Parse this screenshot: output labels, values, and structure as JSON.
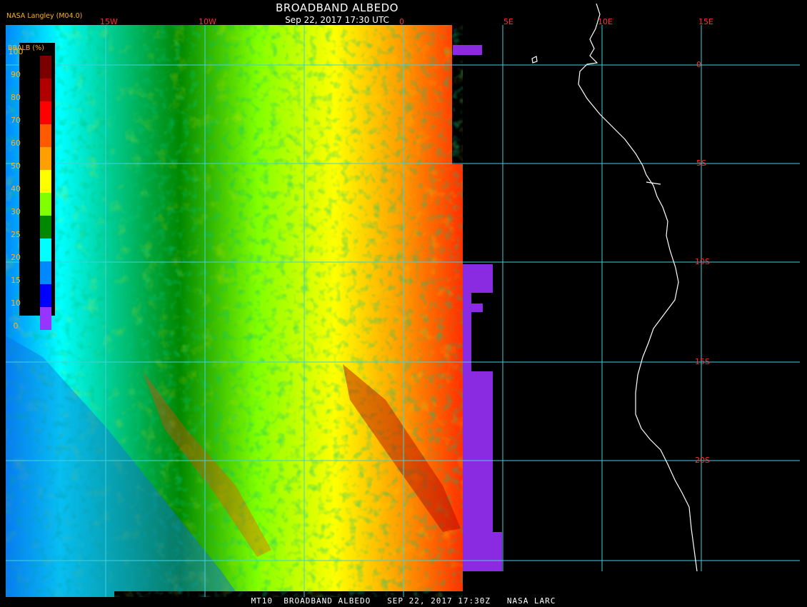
{
  "header": {
    "producer": "NASA Langley (M04.0)",
    "title": "BROADBAND ALBEDO",
    "subtitle": "Sep 22, 2017 17:30 UTC"
  },
  "footer": "MT10  BROADBAND ALBEDO   SEP 22, 2017 17:30Z   NASA LARC",
  "legend": {
    "title": "BBALB (%)",
    "ticks": [
      "100",
      "90",
      "80",
      "70",
      "60",
      "50",
      "40",
      "30",
      "25",
      "20",
      "15",
      "10",
      "0"
    ],
    "colors": [
      "#7a0000",
      "#b00000",
      "#ff0000",
      "#ff5a00",
      "#ffa000",
      "#ffff00",
      "#80ff00",
      "#008800",
      "#00ffff",
      "#0088ff",
      "#0000ff",
      "#9933ff"
    ]
  },
  "grid": {
    "lon_labels": [
      "15W",
      "10W",
      "0",
      "5E",
      "10E",
      "15E"
    ],
    "lat_labels": [
      "0",
      "5S",
      "10S",
      "15S",
      "20S"
    ]
  },
  "colors": {
    "grid_line": "#40d0e0",
    "coastline": "#ffffff",
    "no_data": "#8a2be2",
    "background": "#000000"
  }
}
